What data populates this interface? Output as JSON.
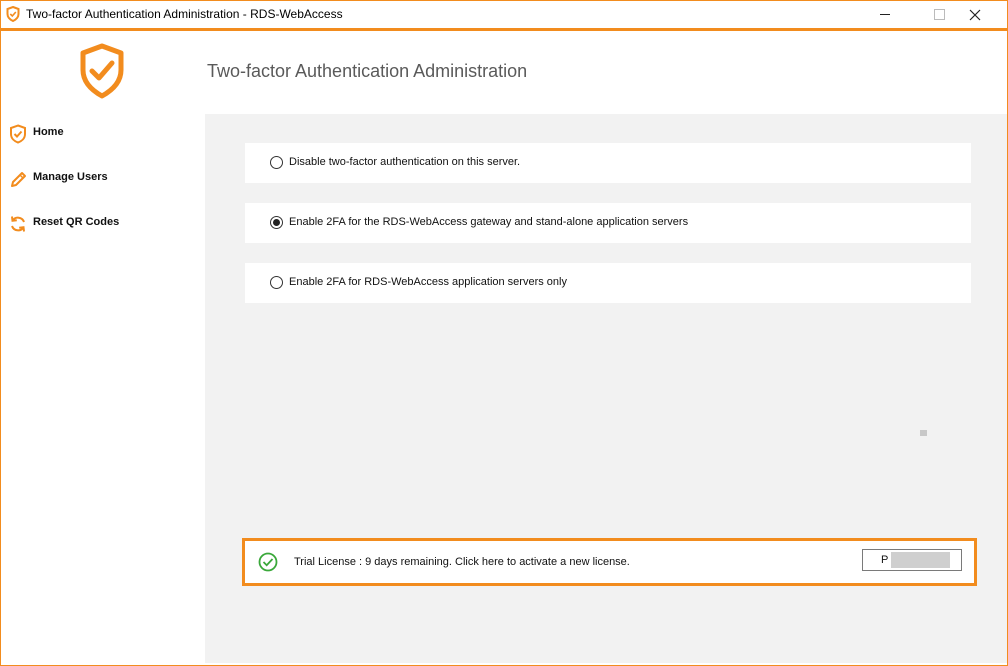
{
  "window": {
    "title": "Two-factor Authentication Administration - RDS-WebAccess",
    "controls": [
      "minimize-icon",
      "maximize-icon",
      "close-icon"
    ]
  },
  "header": {
    "title": "Two-factor Authentication Administration",
    "logo": "shield-check-icon"
  },
  "sidebar": {
    "items": [
      {
        "label": "Home",
        "icon": "shield-check-icon"
      },
      {
        "label": "Manage Users",
        "icon": "pencil-icon"
      },
      {
        "label": "Reset QR Codes",
        "icon": "refresh-icon"
      }
    ]
  },
  "options": [
    {
      "label": "Disable two-factor authentication on this server.",
      "checked": false
    },
    {
      "label": "Enable 2FA for the RDS-WebAccess gateway and stand-alone application servers",
      "checked": true
    },
    {
      "label": "Enable 2FA for RDS-WebAccess application servers only",
      "checked": false
    }
  ],
  "license": {
    "text": "Trial License : 9 days remaining. Click here to activate a new license.",
    "field_value": "P",
    "icon": "check-circle-icon"
  },
  "colors": {
    "accent": "#f28c1e",
    "content_bg": "#f2f2f2",
    "success": "#3aa83a"
  }
}
